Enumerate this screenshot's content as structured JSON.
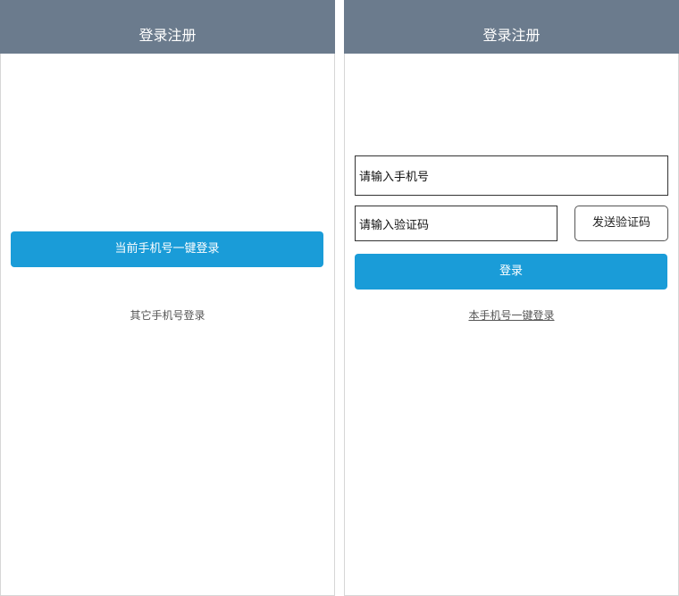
{
  "left_screen": {
    "header": {
      "title": "登录注册"
    },
    "one_click_login_button": "当前手机号一键登录",
    "other_phone_login_link": "其它手机号登录"
  },
  "right_screen": {
    "header": {
      "title": "登录注册"
    },
    "phone_input": {
      "placeholder": "请输入手机号"
    },
    "code_input": {
      "placeholder": "请输入验证码"
    },
    "send_code_button": "发送验证码",
    "login_button": "登录",
    "one_click_login_link": "本手机号一键登录"
  },
  "colors": {
    "header_background": "#6b7b8d",
    "primary_button": "#1a9cd8"
  }
}
